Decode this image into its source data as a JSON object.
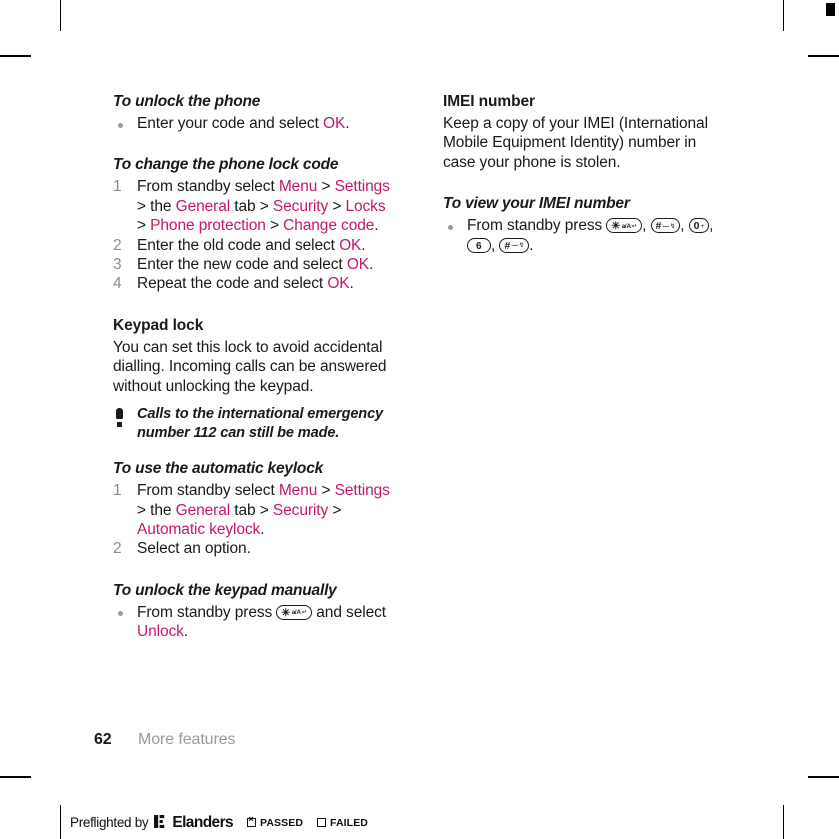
{
  "document": {
    "folio": {
      "page_number": "62",
      "chapter": "More features"
    },
    "link_color": "#c3186c",
    "step_number_color": "#8e8e8e"
  },
  "left_column": {
    "task_unlock_phone": {
      "heading": "To unlock the phone",
      "bullet_1_pre": "Enter your code and select ",
      "bullet_1_ui": "OK",
      "bullet_1_post": "."
    },
    "task_change_code": {
      "heading": "To change the phone lock code",
      "step1_a": "From standby select ",
      "step1_ui1": "Menu",
      "step1_b": " > ",
      "step1_ui2": "Settings",
      "step1_c": " > the ",
      "step1_ui3": "General",
      "step1_d": " tab > ",
      "step1_ui4": "Security",
      "step1_e": " > ",
      "step1_ui5": "Locks",
      "step1_f": " > ",
      "step1_ui6": "Phone protection",
      "step1_g": " > ",
      "step1_ui7": "Change code",
      "step1_h": ".",
      "step2_a": "Enter the old code and select ",
      "step2_ui": "OK",
      "step2_b": ".",
      "step3_a": "Enter the new code and select ",
      "step3_ui": "OK",
      "step3_b": ".",
      "step4_a": "Repeat the code and select ",
      "step4_ui": "OK",
      "step4_b": "."
    },
    "keypad_lock": {
      "heading": "Keypad lock",
      "body": "You can set this lock to avoid accidental dialling. Incoming calls can be answered without unlocking the keypad."
    },
    "note": {
      "icon": "exclamation-icon",
      "text": "Calls to the international emergency number 112 can still be made."
    },
    "task_auto_keylock": {
      "heading": "To use the automatic keylock",
      "step1_a": "From standby select ",
      "step1_ui1": "Menu",
      "step1_b": " > ",
      "step1_ui2": "Settings",
      "step1_c": " > the ",
      "step1_ui3": "General",
      "step1_d": " tab > ",
      "step1_ui4": "Security",
      "step1_e": " > ",
      "step1_ui5": "Automatic keylock",
      "step1_f": ".",
      "step2": "Select an option."
    },
    "task_unlock_keypad": {
      "heading": "To unlock the keypad manually",
      "bullet_pre": "From standby press ",
      "bullet_key": {
        "main": "✳",
        "sub": "a/A",
        "arrow": "↵"
      },
      "bullet_mid": " and select ",
      "bullet_ui": "Unlock",
      "bullet_post": "."
    }
  },
  "right_column": {
    "imei": {
      "heading": "IMEI number",
      "body": "Keep a copy of your IMEI (International Mobile Equipment Identity) number in case your phone is stolen."
    },
    "task_view_imei": {
      "heading": "To view your IMEI number",
      "bullet_pre": "From standby press ",
      "keys": [
        {
          "main": "✳",
          "sub": "a/A",
          "arrow": "↵",
          "type": "star"
        },
        {
          "main": "#",
          "sub": "—",
          "arrow": "↯",
          "type": "hash"
        },
        {
          "main": "0",
          "sub": "",
          "arrow": "+",
          "type": "num"
        },
        {
          "main": "6",
          "sub": "",
          "arrow": "",
          "type": "num"
        },
        {
          "main": "#",
          "sub": "—",
          "arrow": "↯",
          "type": "hash"
        }
      ],
      "sep_comma": ", ",
      "bullet_post": "."
    }
  },
  "preflight": {
    "label": "Preflighted by",
    "brand": "Elanders",
    "passed_label": "PASSED",
    "failed_label": "FAILED",
    "passed_checked": true,
    "failed_checked": false
  }
}
